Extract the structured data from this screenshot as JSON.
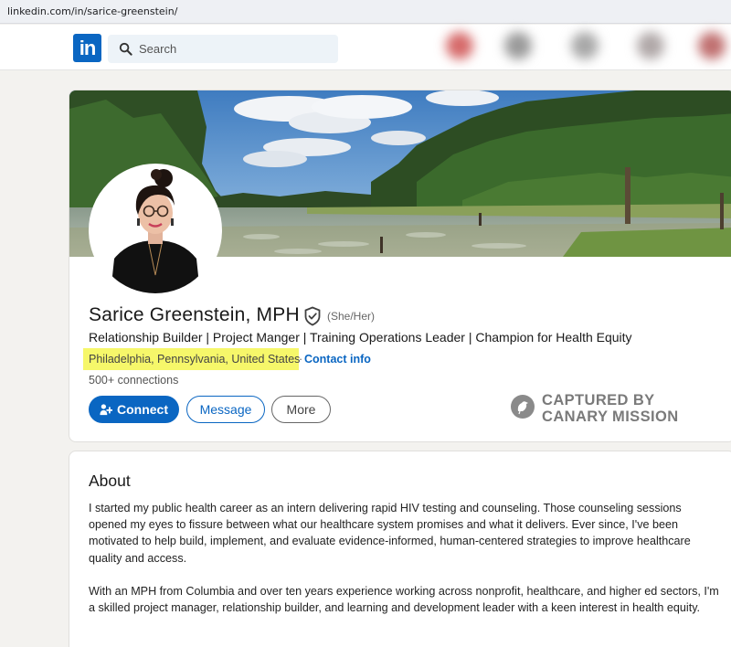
{
  "browser": {
    "url": "linkedin.com/in/sarice-greenstein/"
  },
  "nav": {
    "logo_text": "in",
    "search_placeholder": "Search"
  },
  "profile": {
    "name": "Sarice Greenstein, MPH",
    "pronouns": "(She/Her)",
    "headline": "Relationship Builder | Project Manger | Training Operations Leader | Champion for Health Equity",
    "location": "Philadelphia, Pennsylvania, United States",
    "separator": "·",
    "contact_info": "Contact info",
    "connections": "500+ connections",
    "actions": {
      "connect": "Connect",
      "message": "Message",
      "more": "More"
    }
  },
  "watermark": {
    "line1": "CAPTURED BY",
    "line2": "CANARY MISSION"
  },
  "about": {
    "title": "About",
    "paragraph1": "I started my public health career as an intern delivering rapid HIV testing and counseling. Those counseling sessions opened my eyes to fissure between what our healthcare system promises and what it delivers. Ever since, I've been motivated to help build, implement, and evaluate evidence-informed, human-centered strategies to improve healthcare quality and access.",
    "paragraph2": "With an MPH from Columbia and over ten years experience working across nonprofit, healthcare, and higher ed sectors, I'm a skilled project manager, relationship builder, and learning and development leader with a keen interest in health equity."
  },
  "colors": {
    "brand": "#0a66c2",
    "highlight": "#f6f76a",
    "page_bg": "#f3f2ef"
  },
  "icons": [
    "search-icon",
    "verified-shield-icon",
    "add-person-icon",
    "canary-bird-icon"
  ]
}
